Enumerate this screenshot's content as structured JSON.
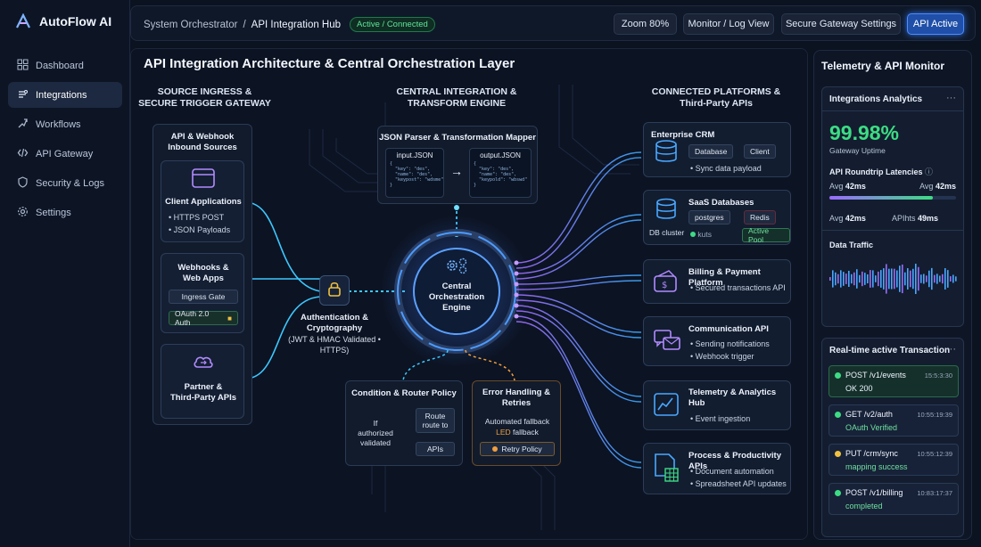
{
  "app": {
    "name": "AutoFlow AI"
  },
  "sidebar": {
    "items": [
      {
        "label": "Dashboard",
        "icon": "dashboard-icon",
        "active": false
      },
      {
        "label": "Integrations",
        "icon": "integrations-icon",
        "active": true
      },
      {
        "label": "Workflows",
        "icon": "workflows-icon",
        "active": false
      },
      {
        "label": "API Gateway",
        "icon": "api-gateway-icon",
        "active": false
      },
      {
        "label": "Security & Logs",
        "icon": "shield-icon",
        "active": false
      },
      {
        "label": "Settings",
        "icon": "gear-icon",
        "active": false
      }
    ]
  },
  "topbar": {
    "breadcrumb_root": "System Orchestrator",
    "breadcrumb_sep": "/",
    "breadcrumb_current": "API Integration Hub",
    "status": "Active / Connected",
    "zoom_label": "Zoom",
    "zoom_value": "80%",
    "monitor_label": "Monitor / Log View",
    "gateway_label": "Secure Gateway Settings",
    "api_active_label": "API Active"
  },
  "main": {
    "title": "API Integration Architecture & Central Orchestration Layer",
    "col_source": "SOURCE INGRESS &\nSECURE TRIGGER GATEWAY",
    "col_engine": "CENTRAL INTEGRATION &\nTRANSFORM ENGINE",
    "col_platforms": "CONNECTED PLATFORMS &\nThird-Party APIs",
    "sources": {
      "title": "API & Webhook\nInbound Sources",
      "client": {
        "title": "Client Applications",
        "bullets": [
          "HTTPS POST",
          "JSON Payloads"
        ]
      },
      "webhooks": {
        "title": "Webhooks &\nWeb Apps",
        "gate": "Ingress Gate",
        "auth": "OAuth 2.0 Auth"
      },
      "partner": {
        "title": "Partner &\nThird-Party APIs"
      }
    },
    "auth": {
      "title": "Authentication &\nCryptography",
      "subtitle": "(JWT & HMAC Validated •\nHTTPS)"
    },
    "mapper": {
      "title": "JSON Parser & Transformation Mapper",
      "input_label": "input.JSON",
      "output_label": "output.JSON",
      "input_code": "{\n  \"key\": \"des\",\n  \"name\": \"des\",\n  \"keypost\": \"wdsme\"\n}",
      "output_code": "{\n  \"key\": \"des\",\n  \"name\": \"des\",\n  \"keypold\": \"wbswd\"\n}",
      "arrow": "→"
    },
    "engine": {
      "label": "Central\nOrchestration\nEngine"
    },
    "router": {
      "title": "Condition & Router Policy",
      "condition": "If\nauthorized\nvalidated",
      "route": "Route\nroute to",
      "apis": "APIs"
    },
    "errors": {
      "title": "Error Handling &\nRetries",
      "line1": "Automated fallback",
      "led": "LED",
      "line2": "fallback",
      "retry": "Retry Policy"
    },
    "platforms": [
      {
        "title": "Enterprise CRM",
        "icon": "database-icon",
        "chips": [
          "Database",
          "Client"
        ],
        "bullets": [
          "Sync data payload"
        ]
      },
      {
        "title": "SaaS Databases",
        "icon": "db-cluster-icon",
        "caption": "DB cluster",
        "chips": [
          "postgres",
          "Redis",
          "kuts",
          "Active Pool"
        ],
        "bullets": []
      },
      {
        "title": "Billing & Payment Platform",
        "icon": "payment-icon",
        "chips": [],
        "bullets": [
          "Secured transactions API"
        ]
      },
      {
        "title": "Communication API",
        "icon": "chat-icon",
        "chips": [],
        "bullets": [
          "Sending notifications",
          "Webhook trigger"
        ]
      },
      {
        "title": "Telemetry & Analytics\nHub",
        "icon": "analytics-icon",
        "chips": [],
        "bullets": [
          "Event ingestion"
        ]
      },
      {
        "title": "Process & Productivity APIs",
        "icon": "spreadsheet-icon",
        "chips": [],
        "bullets": [
          "Document automation",
          "Spreadsheet API updates"
        ]
      }
    ]
  },
  "monitor": {
    "title": "Telemetry & API Monitor",
    "analytics": {
      "title": "Integrations Analytics",
      "uptime": "99.98%",
      "uptime_label": "Gateway Uptime",
      "latency_title": "API Roundtrip Latencies",
      "avg_left_label": "Avg",
      "avg_left_value": "42ms",
      "avg_right_label": "Avg",
      "avg_right_value": "42ms",
      "avg_bottom_label": "Avg",
      "avg_bottom_value": "42ms",
      "apihts_label": "APIhts",
      "apihts_value": "49ms",
      "latency_fill": 0.82,
      "traffic_title": "Data Traffic"
    },
    "transactions_title": "Real-time active Transaction",
    "transactions": [
      {
        "method": "POST /v1/events",
        "status": "OK 200",
        "time": "15:5:3:30"
      },
      {
        "method": "GET /v2/auth",
        "status": "OAuth Verified",
        "time": "10:55:19:39"
      },
      {
        "method": "PUT /crm/sync",
        "status": "mapping success",
        "time": "10:55:12:39"
      },
      {
        "method": "POST /v1/billing",
        "status": "completed",
        "time": "10:83:17:37"
      }
    ]
  },
  "colors": {
    "accent": "#3da5ff",
    "success": "#3ddc84",
    "purple": "#9b6bff",
    "warning": "#f0a040"
  }
}
